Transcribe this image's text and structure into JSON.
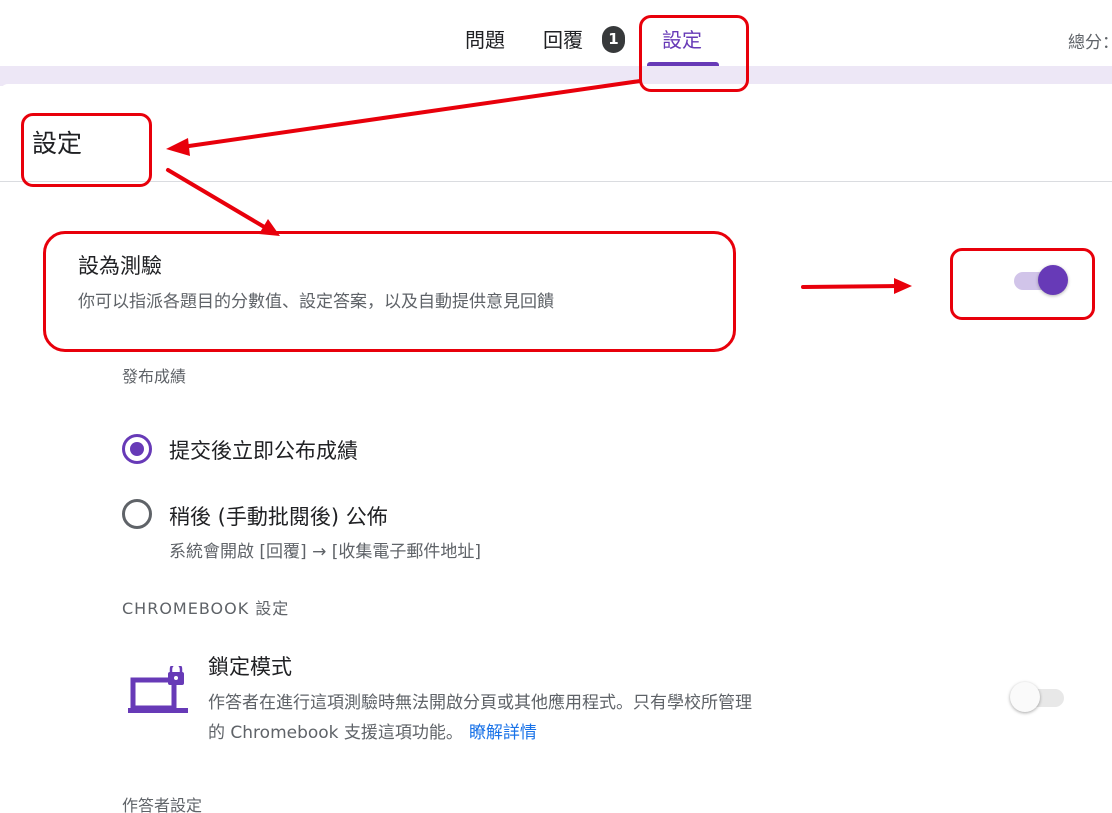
{
  "tabs": {
    "questions": "問題",
    "responses": "回覆",
    "responses_count": "1",
    "settings": "設定"
  },
  "header": {
    "total_points": "總分："
  },
  "settings": {
    "title": "設定",
    "quiz": {
      "title": "設為測驗",
      "description": "你可以指派各題目的分數值、設定答案，以及自動提供意見回饋",
      "enabled": true
    },
    "release_grade": {
      "label": "發布成績",
      "options": [
        {
          "label": "提交後立即公布成績",
          "selected": true
        },
        {
          "label": "稍後 (手動批閱後) 公佈",
          "sublabel": "系統會開啟 [回覆] → [收集電子郵件地址]",
          "selected": false
        }
      ]
    },
    "chromebook": {
      "label": "CHROMEBOOK 設定",
      "locked_mode": {
        "title": "鎖定模式",
        "description_line1": "作答者在進行這項測驗時無法開啟分頁或其他應用程式。只有學校所管理",
        "description_line2": "的 Chromebook 支援這項功能。",
        "learn_more": "瞭解詳情",
        "enabled": false,
        "icon": "laptop-lock-icon"
      }
    },
    "respondent": {
      "label": "作答者設定"
    }
  },
  "colors": {
    "accent": "#673ab7",
    "accent_light": "#d1c4e9",
    "header_strip": "#ede7f6",
    "link": "#1a73e8",
    "annotation": "#e8000b"
  }
}
